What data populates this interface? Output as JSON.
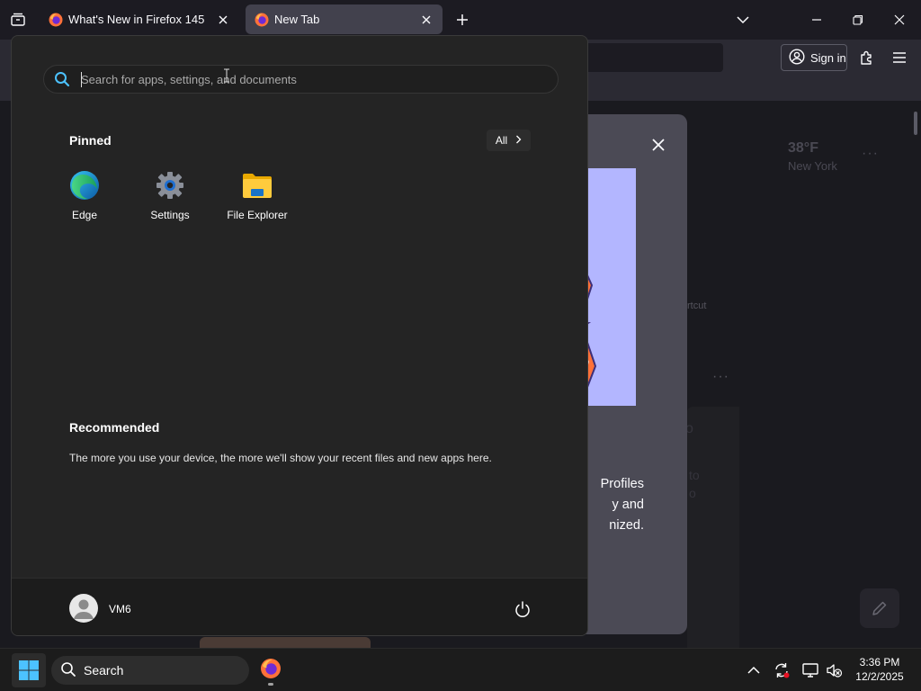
{
  "browser": {
    "tabs": [
      {
        "title": "What's New in Firefox 145",
        "active": false
      },
      {
        "title": "New Tab",
        "active": true
      }
    ],
    "signin_label": "Sign in"
  },
  "newtab": {
    "weather_temp": "38°F",
    "weather_city": "New York",
    "shortcut_label_fragment": "rtcut",
    "faint_fragments": [
      "o",
      "to",
      "o"
    ]
  },
  "profiles_dialog": {
    "text_lines": [
      "Profiles",
      "y and",
      "nized."
    ]
  },
  "start_menu": {
    "search_placeholder": "Search for apps, settings, and documents",
    "pinned_title": "Pinned",
    "all_label": "All",
    "pinned_apps": [
      {
        "label": "Edge",
        "icon": "edge-icon"
      },
      {
        "label": "Settings",
        "icon": "gear-icon"
      },
      {
        "label": "File Explorer",
        "icon": "folder-icon"
      }
    ],
    "recommended_title": "Recommended",
    "recommended_text": "The more you use your device, the more we'll show your recent files and new apps here.",
    "user_name": "VM6"
  },
  "taskbar": {
    "search_label": "Search",
    "time": "3:36 PM",
    "date": "12/2/2025"
  },
  "colors": {
    "accent_blue": "#0078d4",
    "firefox_orange": "#ff7139",
    "start_bg": "#242424"
  }
}
